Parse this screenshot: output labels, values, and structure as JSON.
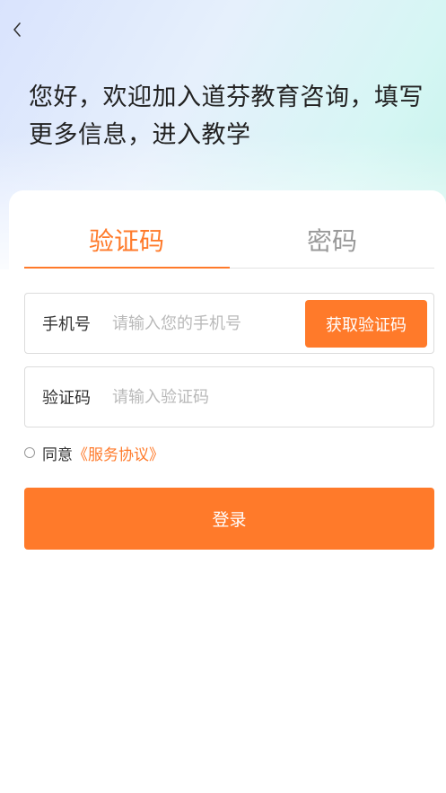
{
  "colors": {
    "accent": "#ff7a2a",
    "tab_inactive": "#999999",
    "text": "#222222",
    "placeholder": "#b9b9b9"
  },
  "header": {
    "back_icon": "chevron-left-icon",
    "welcome": "您好，欢迎加入道芬教育咨询，填写更多信息，进入教学"
  },
  "tabs": {
    "active": "验证码",
    "items": [
      {
        "label": "验证码"
      },
      {
        "label": "密码"
      }
    ]
  },
  "form": {
    "phone_label": "手机号",
    "phone_placeholder": "请输入您的手机号",
    "phone_value": "",
    "get_code_label": "获取验证码",
    "code_label": "验证码",
    "code_placeholder": "请输入验证码",
    "code_value": ""
  },
  "agreement": {
    "prefix": "同意",
    "link": "《服务协议》",
    "checked": false
  },
  "login_label": "登录"
}
